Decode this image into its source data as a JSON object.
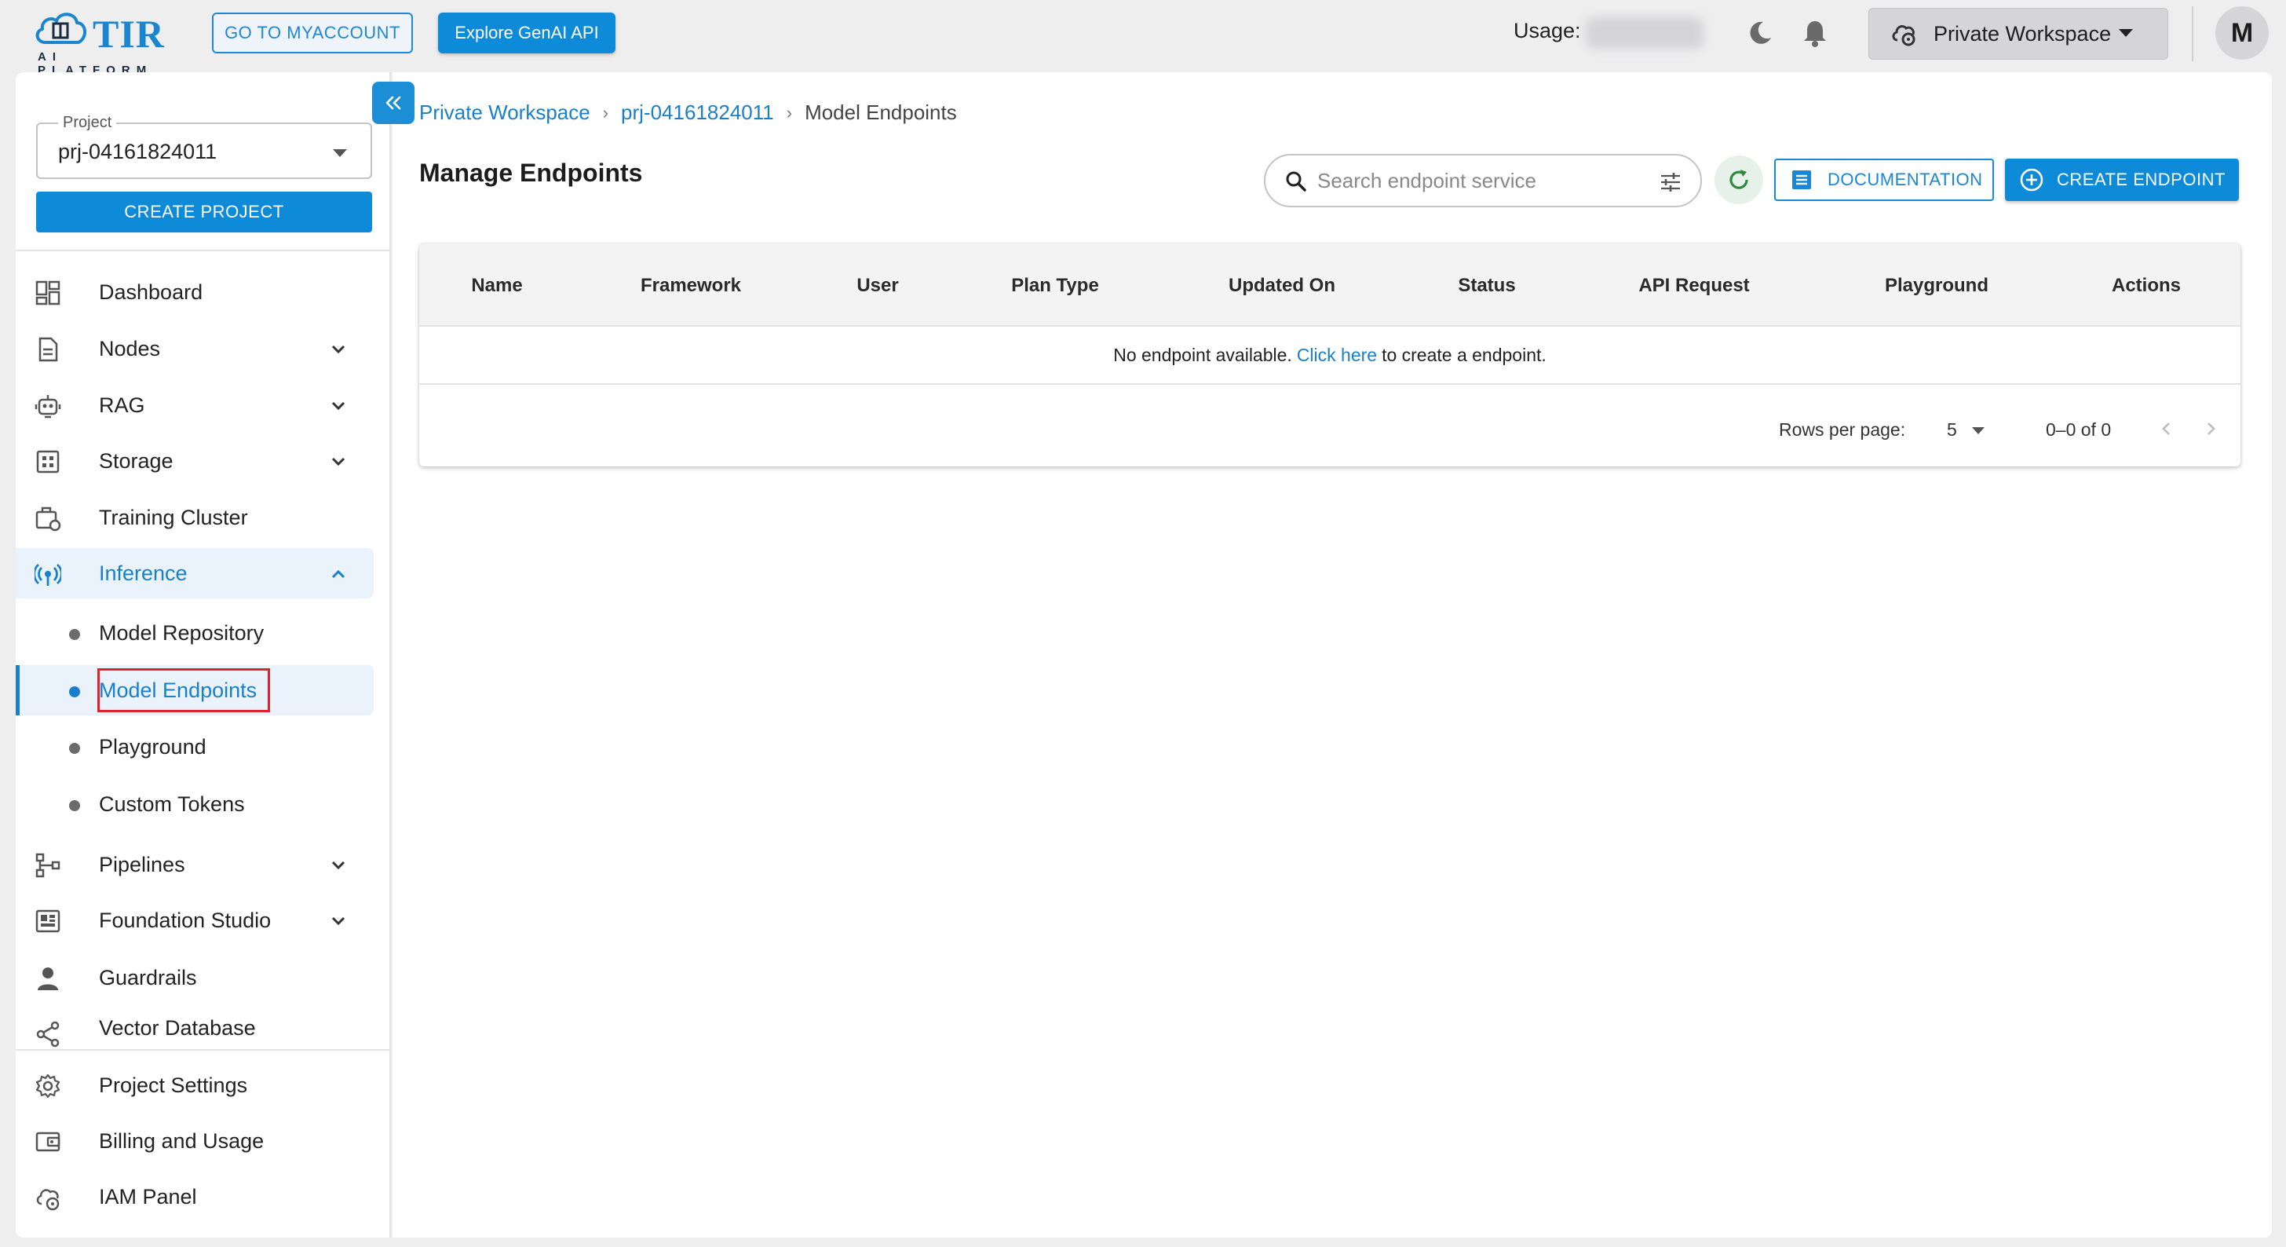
{
  "header": {
    "logo_text": "TIR",
    "logo_subtitle": "AI PLATFORM",
    "myaccount_button": "GO TO MYACCOUNT",
    "genai_button": "Explore GenAI API",
    "usage_label": "Usage:",
    "workspace_selector": "Private Workspace",
    "avatar_initial": "M"
  },
  "sidebar": {
    "project_label": "Project",
    "project_value": "prj-04161824011",
    "create_project_button": "CREATE PROJECT",
    "items": [
      {
        "label": "Dashboard",
        "icon": "dashboard-icon"
      },
      {
        "label": "Nodes",
        "icon": "nodes-icon",
        "expandable": true
      },
      {
        "label": "RAG",
        "icon": "rag-icon",
        "expandable": true
      },
      {
        "label": "Storage",
        "icon": "storage-icon",
        "expandable": true
      },
      {
        "label": "Training Cluster",
        "icon": "training-cluster-icon"
      },
      {
        "label": "Inference",
        "icon": "inference-icon",
        "expanded": true,
        "active": true
      }
    ],
    "inference_subitems": [
      {
        "label": "Model Repository"
      },
      {
        "label": "Model Endpoints",
        "active": true
      },
      {
        "label": "Playground"
      },
      {
        "label": "Custom Tokens"
      }
    ],
    "items_after": [
      {
        "label": "Pipelines",
        "icon": "pipelines-icon",
        "expandable": true
      },
      {
        "label": "Foundation Studio",
        "icon": "foundation-studio-icon",
        "expandable": true
      },
      {
        "label": "Guardrails",
        "icon": "guardrails-icon"
      },
      {
        "label": "Vector Database",
        "icon": "vector-database-icon"
      }
    ],
    "footer_items": [
      {
        "label": "Project Settings",
        "icon": "gear-icon"
      },
      {
        "label": "Billing and Usage",
        "icon": "wallet-icon"
      },
      {
        "label": "IAM Panel",
        "icon": "iam-icon"
      }
    ]
  },
  "breadcrumb": {
    "items": [
      "Private Workspace",
      "prj-04161824011",
      "Model Endpoints"
    ]
  },
  "main": {
    "title": "Manage Endpoints",
    "search_placeholder": "Search endpoint service",
    "documentation_button": "DOCUMENTATION",
    "create_endpoint_button": "CREATE ENDPOINT"
  },
  "table": {
    "columns": [
      "Name",
      "Framework",
      "User",
      "Plan Type",
      "Updated On",
      "Status",
      "API Request",
      "Playground",
      "Actions"
    ],
    "empty_prefix": "No endpoint available.",
    "empty_link": "Click here",
    "empty_suffix": "to create a endpoint.",
    "rows_per_page_label": "Rows per page:",
    "rows_per_page_value": "5",
    "page_range": "0–0 of 0"
  },
  "colors": {
    "accent": "#0d8ad8",
    "link": "#1a7fc9",
    "focus_outline": "#e0222a",
    "refresh_icon": "#2e8b3e"
  }
}
